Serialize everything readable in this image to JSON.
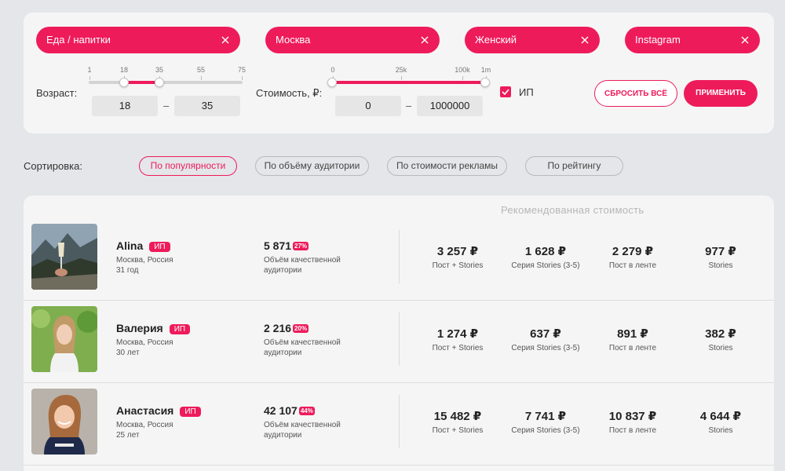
{
  "filters": {
    "chips": [
      {
        "label": "Еда / напитки"
      },
      {
        "label": "Москва"
      },
      {
        "label": "Женский"
      },
      {
        "label": "Instagram"
      }
    ],
    "age": {
      "label": "Возраст:",
      "scale": [
        "1",
        "18",
        "35",
        "55",
        "75"
      ],
      "min": "18",
      "max": "35"
    },
    "cost": {
      "label": "Стоимость, ₽:",
      "scale": [
        "0",
        "25k",
        "100k",
        "1m"
      ],
      "min": "0",
      "max": "1000000"
    },
    "ip_checkbox": {
      "label": "ИП",
      "checked": true
    },
    "dash": "–",
    "reset_label": "СБРОСИТЬ ВСЁ",
    "apply_label": "ПРИМЕНИТЬ"
  },
  "sorting": {
    "label": "Сортировка:",
    "options": [
      "По популярности",
      "По объёму аудитории",
      "По стоимости рекламы",
      "По рейтингу"
    ],
    "active_index": 0
  },
  "results": {
    "recommended_title": "Рекомендованная стоимость",
    "price_labels": [
      "Пост + Stories",
      "Серия Stories (3-5)",
      "Пост в ленте",
      "Stories"
    ],
    "audience_label": "Объём качественной аудитории",
    "items": [
      {
        "name": "Alina",
        "badge": "ИП",
        "location": "Москва, Россия",
        "age": "31 год",
        "audience": "5 871",
        "quality_pct": "27%",
        "prices": [
          "3 257 ₽",
          "1 628 ₽",
          "2 279 ₽",
          "977 ₽"
        ]
      },
      {
        "name": "Валерия",
        "badge": "ИП",
        "location": "Москва, Россия",
        "age": "30 лет",
        "audience": "2 216",
        "quality_pct": "20%",
        "prices": [
          "1 274 ₽",
          "637 ₽",
          "891 ₽",
          "382 ₽"
        ]
      },
      {
        "name": "Анастасия",
        "badge": "ИП",
        "location": "Москва, Россия",
        "age": "25 лет",
        "audience": "42 107",
        "quality_pct": "44%",
        "prices": [
          "15 482 ₽",
          "7 741 ₽",
          "10 837 ₽",
          "4 644 ₽"
        ]
      }
    ]
  },
  "colors": {
    "accent": "#ee1b5b",
    "background": "#e4e6e9",
    "panel": "#f5f5f5"
  }
}
